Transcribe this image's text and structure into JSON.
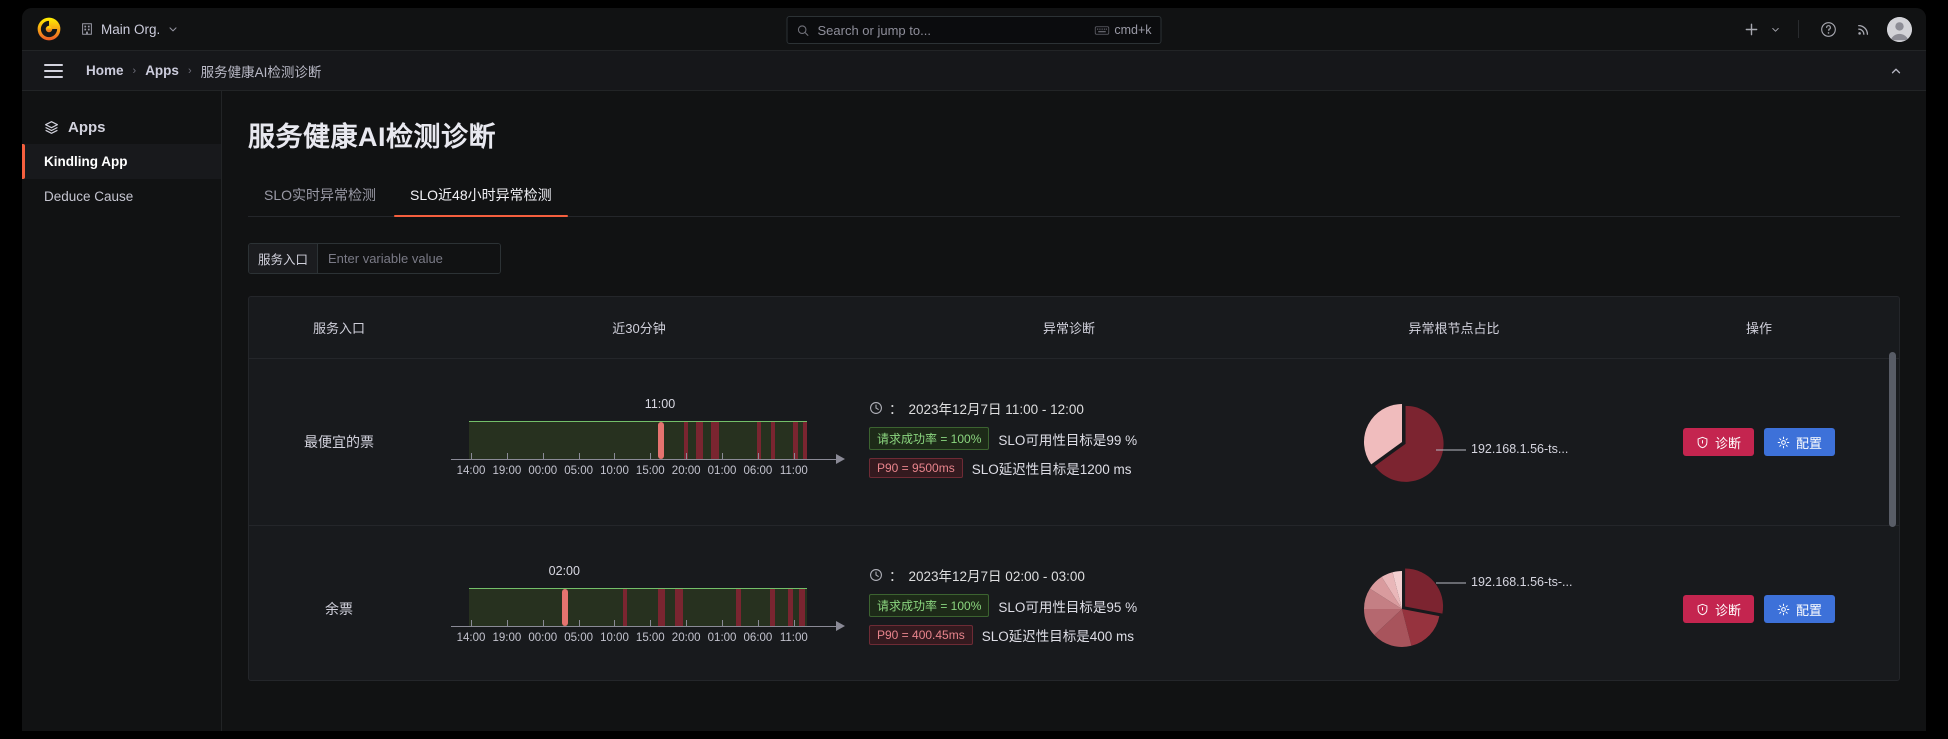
{
  "topnav": {
    "org_label": "Main Org.",
    "org_icon": "building-icon",
    "logo_icon": "grafana-logo-icon",
    "chevron_icon": "chevron-down-icon",
    "search": {
      "placeholder": "Search or jump to...",
      "shortcut": "cmd+k",
      "icon": "search-icon",
      "kbd_icon": "keyboard-icon"
    },
    "actions": [
      {
        "name": "add-new-button",
        "icon": "plus-icon"
      },
      {
        "name": "help-button",
        "icon": "question-circle-icon"
      },
      {
        "name": "news-button",
        "icon": "rss-icon"
      },
      {
        "name": "profile-avatar",
        "icon": "avatar-icon"
      }
    ]
  },
  "breadcrumb": {
    "menu_icon": "hamburger-menu-icon",
    "collapse_icon": "chevron-up-icon",
    "separator": "›",
    "items": [
      {
        "label": "Home",
        "current": false
      },
      {
        "label": "Apps",
        "current": false
      },
      {
        "label": "服务健康AI检测诊断",
        "current": true
      }
    ]
  },
  "sidebar": {
    "section_label": "Apps",
    "section_icon": "layers-icon",
    "items": [
      {
        "label": "Kindling App",
        "active": true
      },
      {
        "label": "Deduce Cause",
        "active": false
      }
    ]
  },
  "main": {
    "page_title": "服务健康AI检测诊断",
    "tabs": [
      {
        "label": "SLO实时异常检测",
        "active": false
      },
      {
        "label": "SLO近48小时异常检测",
        "active": true
      }
    ],
    "variable": {
      "label": "服务入口",
      "value": "",
      "placeholder": "Enter variable value"
    },
    "table": {
      "columns": [
        "服务入口",
        "近30分钟",
        "异常诊断",
        "异常根节点占比",
        "操作"
      ],
      "rows": [
        {
          "service": "最便宜的票",
          "timeline": {
            "peak_label": "11:00",
            "peak_pos": 0.565,
            "ticks": [
              "14:00",
              "19:00",
              "00:00",
              "05:00",
              "10:00",
              "15:00",
              "20:00",
              "01:00",
              "06:00",
              "11:00"
            ],
            "marks": [
              {
                "pos": 0.558,
                "w": 0.018,
                "highlight": true
              },
              {
                "pos": 0.635,
                "w": 0.013,
                "highlight": false
              },
              {
                "pos": 0.672,
                "w": 0.02,
                "highlight": false
              },
              {
                "pos": 0.717,
                "w": 0.024,
                "highlight": false
              },
              {
                "pos": 0.852,
                "w": 0.013,
                "highlight": false
              },
              {
                "pos": 0.893,
                "w": 0.013,
                "highlight": false
              },
              {
                "pos": 0.96,
                "w": 0.012,
                "highlight": false
              },
              {
                "pos": 0.989,
                "w": 0.011,
                "highlight": false
              }
            ]
          },
          "diagnosis": {
            "time_icon": "clock-icon",
            "time_range": "2023年12月7日 11:00 - 12:00",
            "availability": {
              "badge": "请求成功率 = 100%",
              "text": "SLO可用性目标是99 %"
            },
            "latency": {
              "badge": "P90 = 9500ms",
              "text": "SLO延迟性目标是1200 ms"
            }
          },
          "pie": {
            "label": "192.168.1.56-ts...",
            "slices": [
              {
                "value": 65,
                "color": "#7c2430",
                "exploded": true
              },
              {
                "value": 35,
                "color": "#f0bcbd",
                "exploded": false
              }
            ]
          },
          "actions": [
            {
              "label": "诊断",
              "icon": "shield-icon",
              "style": "diagnose"
            },
            {
              "label": "配置",
              "icon": "gear-icon",
              "style": "config"
            }
          ]
        },
        {
          "service": "余票",
          "timeline": {
            "peak_label": "02:00",
            "peak_pos": 0.282,
            "ticks": [
              "14:00",
              "19:00",
              "00:00",
              "05:00",
              "10:00",
              "15:00",
              "20:00",
              "01:00",
              "06:00",
              "11:00"
            ],
            "marks": [
              {
                "pos": 0.275,
                "w": 0.018,
                "highlight": true
              },
              {
                "pos": 0.455,
                "w": 0.013,
                "highlight": false
              },
              {
                "pos": 0.56,
                "w": 0.02,
                "highlight": false
              },
              {
                "pos": 0.608,
                "w": 0.024,
                "highlight": false
              },
              {
                "pos": 0.79,
                "w": 0.015,
                "highlight": false
              },
              {
                "pos": 0.89,
                "w": 0.014,
                "highlight": false
              },
              {
                "pos": 0.944,
                "w": 0.014,
                "highlight": false
              },
              {
                "pos": 0.977,
                "w": 0.016,
                "highlight": false
              }
            ]
          },
          "diagnosis": {
            "time_icon": "clock-icon",
            "time_range": "2023年12月7日 02:00 - 03:00",
            "availability": {
              "badge": "请求成功率 = 100%",
              "text": "SLO可用性目标是95 %"
            },
            "latency": {
              "badge": "P90 = 400.45ms",
              "text": "SLO延迟性目标是400 ms"
            }
          },
          "pie": {
            "label": "192.168.1.56-ts-...",
            "slices": [
              {
                "value": 28,
                "color": "#7c2430",
                "exploded": true
              },
              {
                "value": 18,
                "color": "#96333e",
                "exploded": false
              },
              {
                "value": 17,
                "color": "#a8545c",
                "exploded": false
              },
              {
                "value": 12,
                "color": "#b5686f",
                "exploded": false
              },
              {
                "value": 9,
                "color": "#c47f84",
                "exploded": false
              },
              {
                "value": 7,
                "color": "#d99b9e",
                "exploded": false
              },
              {
                "value": 5,
                "color": "#e9b7b9",
                "exploded": false
              },
              {
                "value": 4,
                "color": "#f3cfd0",
                "exploded": false
              }
            ]
          },
          "actions": [
            {
              "label": "诊断",
              "icon": "shield-icon",
              "style": "diagnose"
            },
            {
              "label": "配置",
              "icon": "gear-icon",
              "style": "config"
            }
          ]
        }
      ]
    }
  },
  "colors": {
    "accent": "#f55f3e",
    "diagnose_button": "#c4254f",
    "config_button": "#3d71d9",
    "ok_badge": "#8bd67f",
    "bad_badge": "#e8848c",
    "timeline_band": "#27311f",
    "timeline_line": "#73bf69",
    "timeline_anomaly": "#7a2530",
    "timeline_highlight": "#e5736f"
  }
}
